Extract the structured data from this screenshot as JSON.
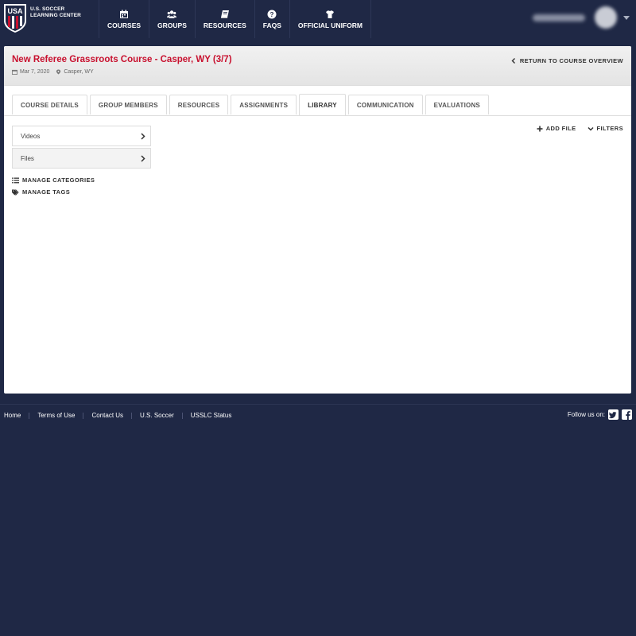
{
  "brand": {
    "line1": "U.S. SOCCER",
    "line2": "LEARNING CENTER",
    "crest_text": "USA"
  },
  "nav": [
    {
      "label": "COURSES",
      "icon": "calendar-icon"
    },
    {
      "label": "GROUPS",
      "icon": "users-icon"
    },
    {
      "label": "RESOURCES",
      "icon": "book-icon"
    },
    {
      "label": "FAQS",
      "icon": "question-circle-icon"
    },
    {
      "label": "OFFICIAL UNIFORM",
      "icon": "shirt-icon"
    }
  ],
  "course": {
    "title": "New Referee Grassroots Course - Casper, WY (3/7)",
    "date": "Mar 7, 2020",
    "location": "Casper, WY",
    "return_label": "RETURN TO COURSE OVERVIEW"
  },
  "tabs": [
    "COURSE DETAILS",
    "GROUP MEMBERS",
    "RESOURCES",
    "ASSIGNMENTS",
    "LIBRARY",
    "COMMUNICATION",
    "EVALUATIONS"
  ],
  "active_tab": "LIBRARY",
  "library": {
    "menu": [
      "Videos",
      "Files"
    ],
    "manage_categories": "MANAGE CATEGORIES",
    "manage_tags": "MANAGE TAGS",
    "add_file": "ADD FILE",
    "filters": "FILTERS"
  },
  "footer": {
    "links": [
      "Home",
      "Terms of Use",
      "Contact Us",
      "U.S. Soccer",
      "USSLC Status"
    ],
    "follow": "Follow us on:"
  },
  "colors": {
    "navy": "#1f2845",
    "accent_red": "#c8102e"
  }
}
